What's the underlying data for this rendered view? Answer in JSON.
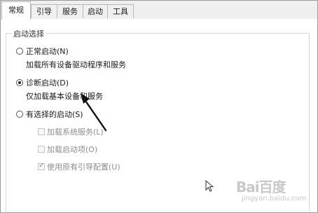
{
  "tabs": [
    {
      "label": "常规",
      "active": true
    },
    {
      "label": "引导",
      "active": false
    },
    {
      "label": "服务",
      "active": false
    },
    {
      "label": "启动",
      "active": false
    },
    {
      "label": "工具",
      "active": false
    }
  ],
  "startup_group": {
    "title": "启动选择",
    "normal": {
      "label": "正常启动(N)",
      "description": "加载所有设备驱动程序和服务",
      "selected": false
    },
    "diagnostic": {
      "label": "诊断启动(D)",
      "description": "仅加载基本设备和服务",
      "selected": true
    },
    "selective": {
      "label": "有选择的启动(S)",
      "selected": false
    },
    "options": [
      {
        "label": "加载系统服务(L)",
        "checked": false
      },
      {
        "label": "加载启动项(O)",
        "checked": false
      },
      {
        "label": "使用原有引导配置(U)",
        "checked": true
      }
    ]
  },
  "watermark": {
    "brand": "Bai百度",
    "sub": "jingyan.baidu.com"
  },
  "colors": {
    "annotation_arrow": "#111111",
    "disabled_text": "#8e8e8e"
  }
}
